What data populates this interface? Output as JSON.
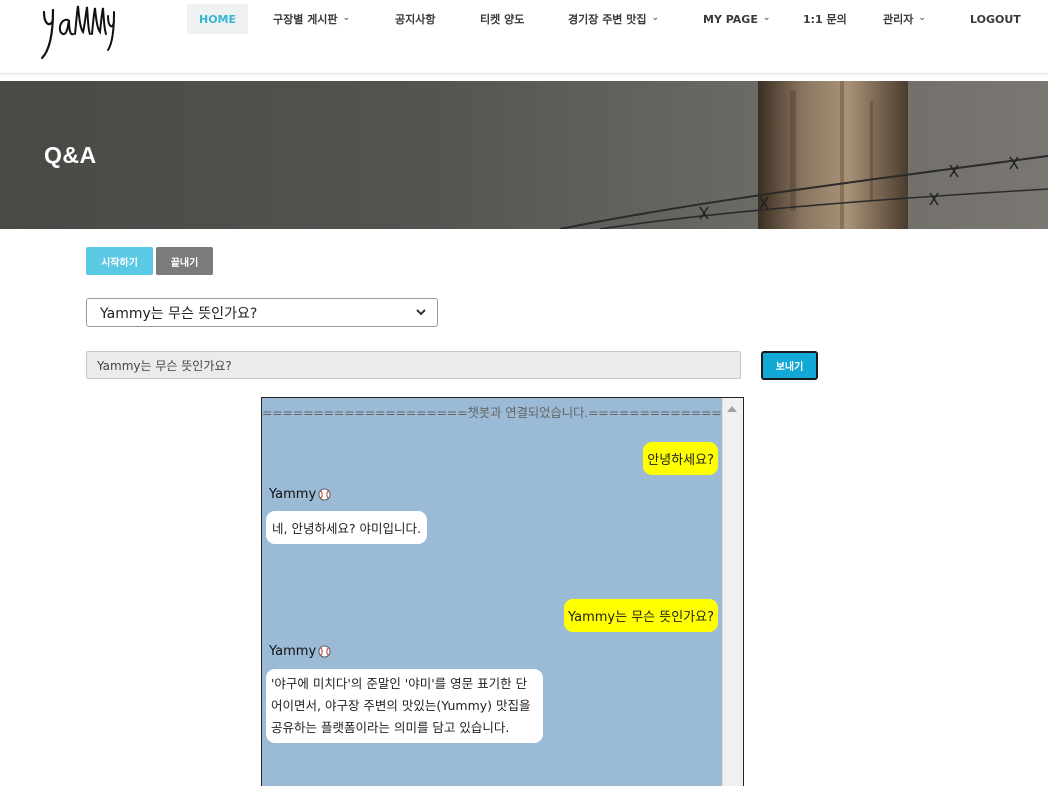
{
  "header": {
    "logo_text": "yammy",
    "nav": [
      {
        "label": "HOME",
        "active": true,
        "dropdown": false
      },
      {
        "label": "구장별 게시판",
        "active": false,
        "dropdown": true
      },
      {
        "label": "공지사항",
        "active": false,
        "dropdown": false
      },
      {
        "label": "티켓 양도",
        "active": false,
        "dropdown": false
      },
      {
        "label": "경기장 주변 맛집",
        "active": false,
        "dropdown": true
      },
      {
        "label": "MY PAGE",
        "active": false,
        "dropdown": true
      },
      {
        "label": "1:1 문의",
        "active": false,
        "dropdown": false
      },
      {
        "label": "관리자",
        "active": false,
        "dropdown": true
      },
      {
        "label": "LOGOUT",
        "active": false,
        "dropdown": false
      }
    ]
  },
  "banner": {
    "title": "Q&A"
  },
  "controls": {
    "start_label": "시작하기",
    "end_label": "끝내기",
    "select_value": "Yammy는 무슨 뜻인가요?",
    "input_value": "Yammy는 무슨 뜻인가요?",
    "send_label": "보내기"
  },
  "chat": {
    "system_message": "====================챗봇과 연결되었습니다.=====================",
    "bot_name": "Yammy",
    "messages": [
      {
        "from": "user",
        "text": "안녕하세요?"
      },
      {
        "from": "bot",
        "text": "네, 안녕하세요? 야미입니다."
      },
      {
        "from": "user",
        "text": "Yammy는 무슨 뜻인가요?"
      },
      {
        "from": "bot",
        "lines": [
          "'야구에 미치다'의 준말인 '야미'를 영문 표기한 단",
          "어이면서, 야구장 주변의 맛있는(Yummy) 맛집을",
          "공유하는 플랫폼이라는 의미를 담고 있습니다."
        ]
      }
    ]
  },
  "colors": {
    "accent": "#38b6d6",
    "start_button": "#5bc8e4",
    "send_button": "#12a9d6",
    "chat_bg": "#9bbad5",
    "user_bubble": "#ffff00"
  }
}
